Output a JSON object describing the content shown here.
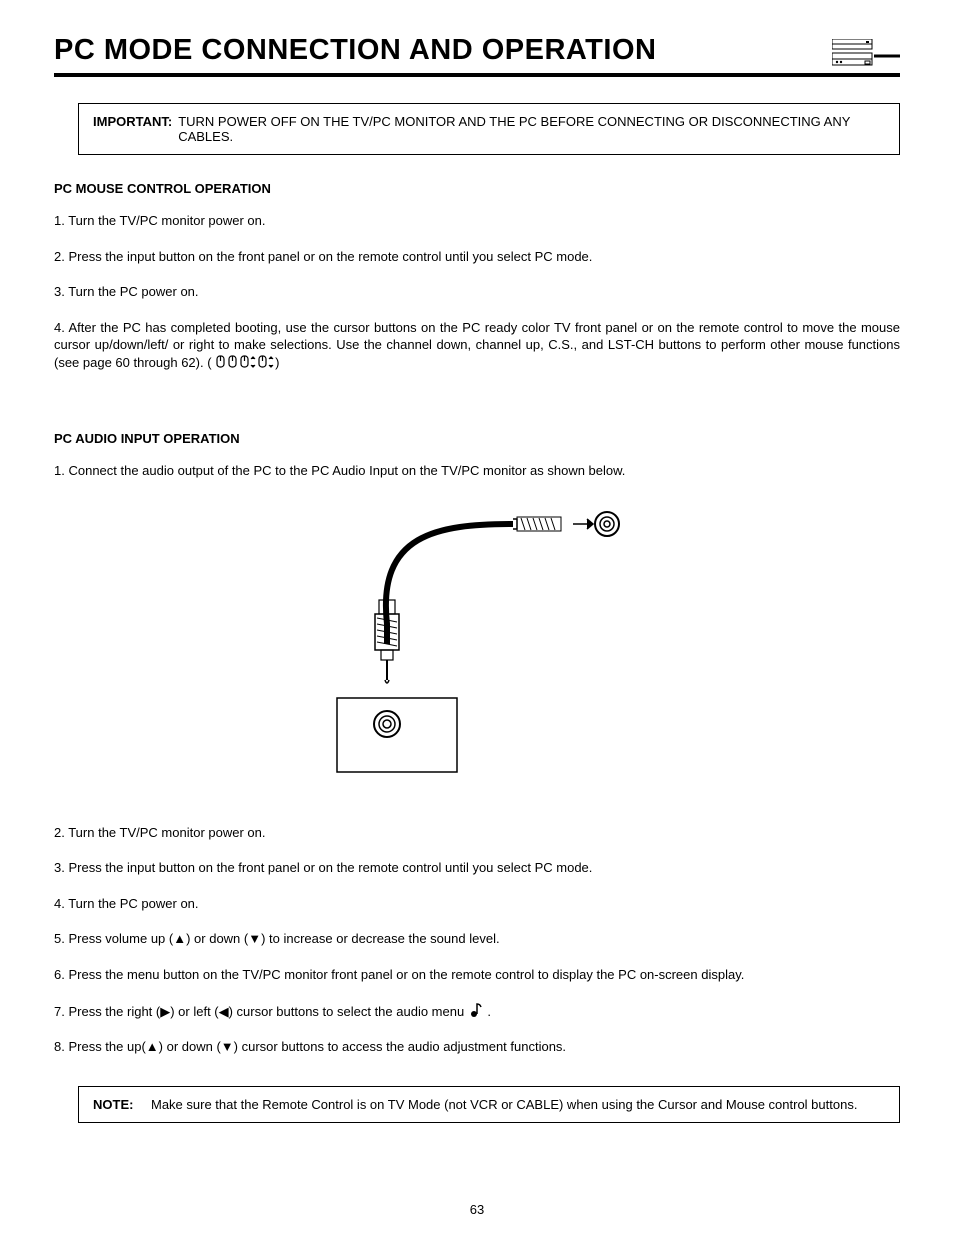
{
  "title": "PC MODE CONNECTION AND OPERATION",
  "important_box": {
    "lead": "IMPORTANT:",
    "text": "TURN POWER OFF ON THE TV/PC MONITOR AND THE PC BEFORE CONNECTING OR DISCONNECTING ANY CABLES."
  },
  "section1": {
    "heading": "PC MOUSE CONTROL OPERATION",
    "steps": [
      "Turn the TV/PC monitor power on.",
      "Press the input button on the front panel or on the remote control until you select PC mode.",
      "Turn the PC power on.",
      "After the PC has completed booting, use the cursor buttons on the PC ready color TV front panel or on the remote control to move the mouse cursor up/down/left/ or right to make selections. Use the channel down, channel up, C.S., and LST-CH buttons to perform other mouse functions (see page 60 through 62). ( "
    ],
    "step4_suffix": ")"
  },
  "section2": {
    "heading": "PC AUDIO INPUT OPERATION",
    "steps": [
      "Connect the audio output of the PC to the PC Audio Input on the TV/PC monitor as shown below.",
      "Turn the TV/PC monitor power on.",
      "Press the input button on the front panel or on the remote control until you select PC mode.",
      "Turn the PC power on.",
      "Press volume up (▲) or down (▼) to increase or decrease the sound level.",
      "Press the menu button on the TV/PC monitor front panel or on the remote control to display the PC on-screen display.",
      " Press the right (▶) or left (◀) cursor buttons to select the audio menu ",
      " Press the up(▲) or down (▼) cursor buttons to access the audio adjustment functions."
    ],
    "step7_suffix": " ."
  },
  "note_box": {
    "lead": "NOTE:",
    "text": "Make sure that the Remote Control is on TV Mode (not VCR or CABLE) when using the Cursor and Mouse control buttons."
  },
  "page_number": "63"
}
